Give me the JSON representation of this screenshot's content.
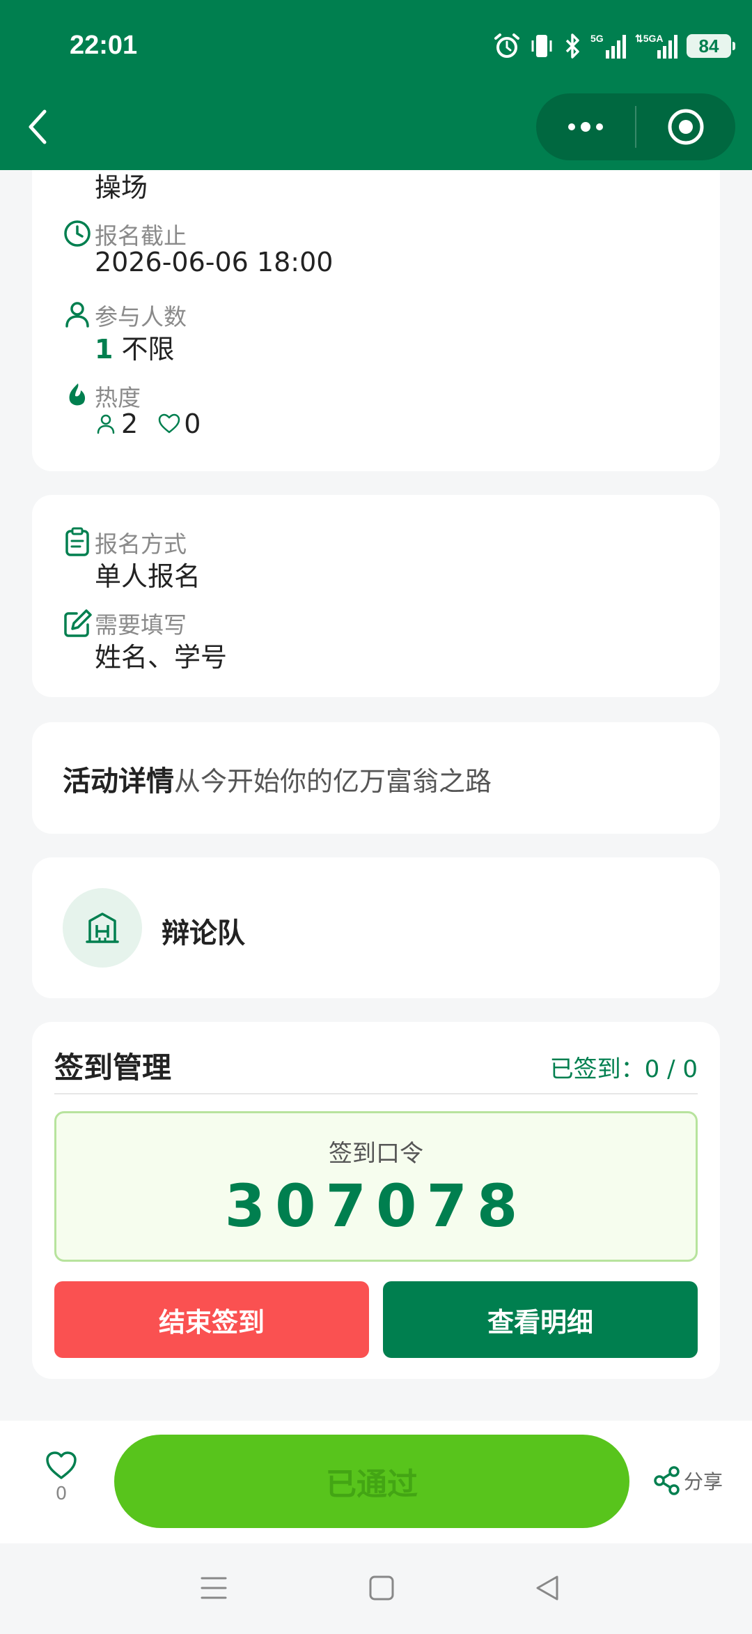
{
  "status_bar": {
    "time": "22:01",
    "battery": "84",
    "network_1": "5G",
    "network_2": "5GA"
  },
  "activity_info": {
    "location_value": "操场",
    "deadline_label": "报名截止",
    "deadline_value": "2026-06-06 18:00",
    "participants_label": "参与人数",
    "participants_count": "1",
    "participants_limit": "不限",
    "popularity_label": "热度",
    "views": "2",
    "likes": "0"
  },
  "signup": {
    "method_label": "报名方式",
    "method_value": "单人报名",
    "fields_label": "需要填写",
    "fields_value": "姓名、学号"
  },
  "details": {
    "title": "活动详情",
    "text": "从今开始你的亿万富翁之路"
  },
  "organizer": {
    "name": "辩论队"
  },
  "checkin": {
    "title": "签到管理",
    "count_text": "已签到：0 / 0",
    "code_label": "签到口令",
    "code": "307078",
    "end_button": "结束签到",
    "detail_button": "查看明细"
  },
  "bottom_bar": {
    "favorite_count": "0",
    "status_button": "已通过",
    "share_label": "分享"
  },
  "colors": {
    "brand_green": "#007f4f",
    "status_green": "#58c41c",
    "danger_red": "#fa5151"
  }
}
